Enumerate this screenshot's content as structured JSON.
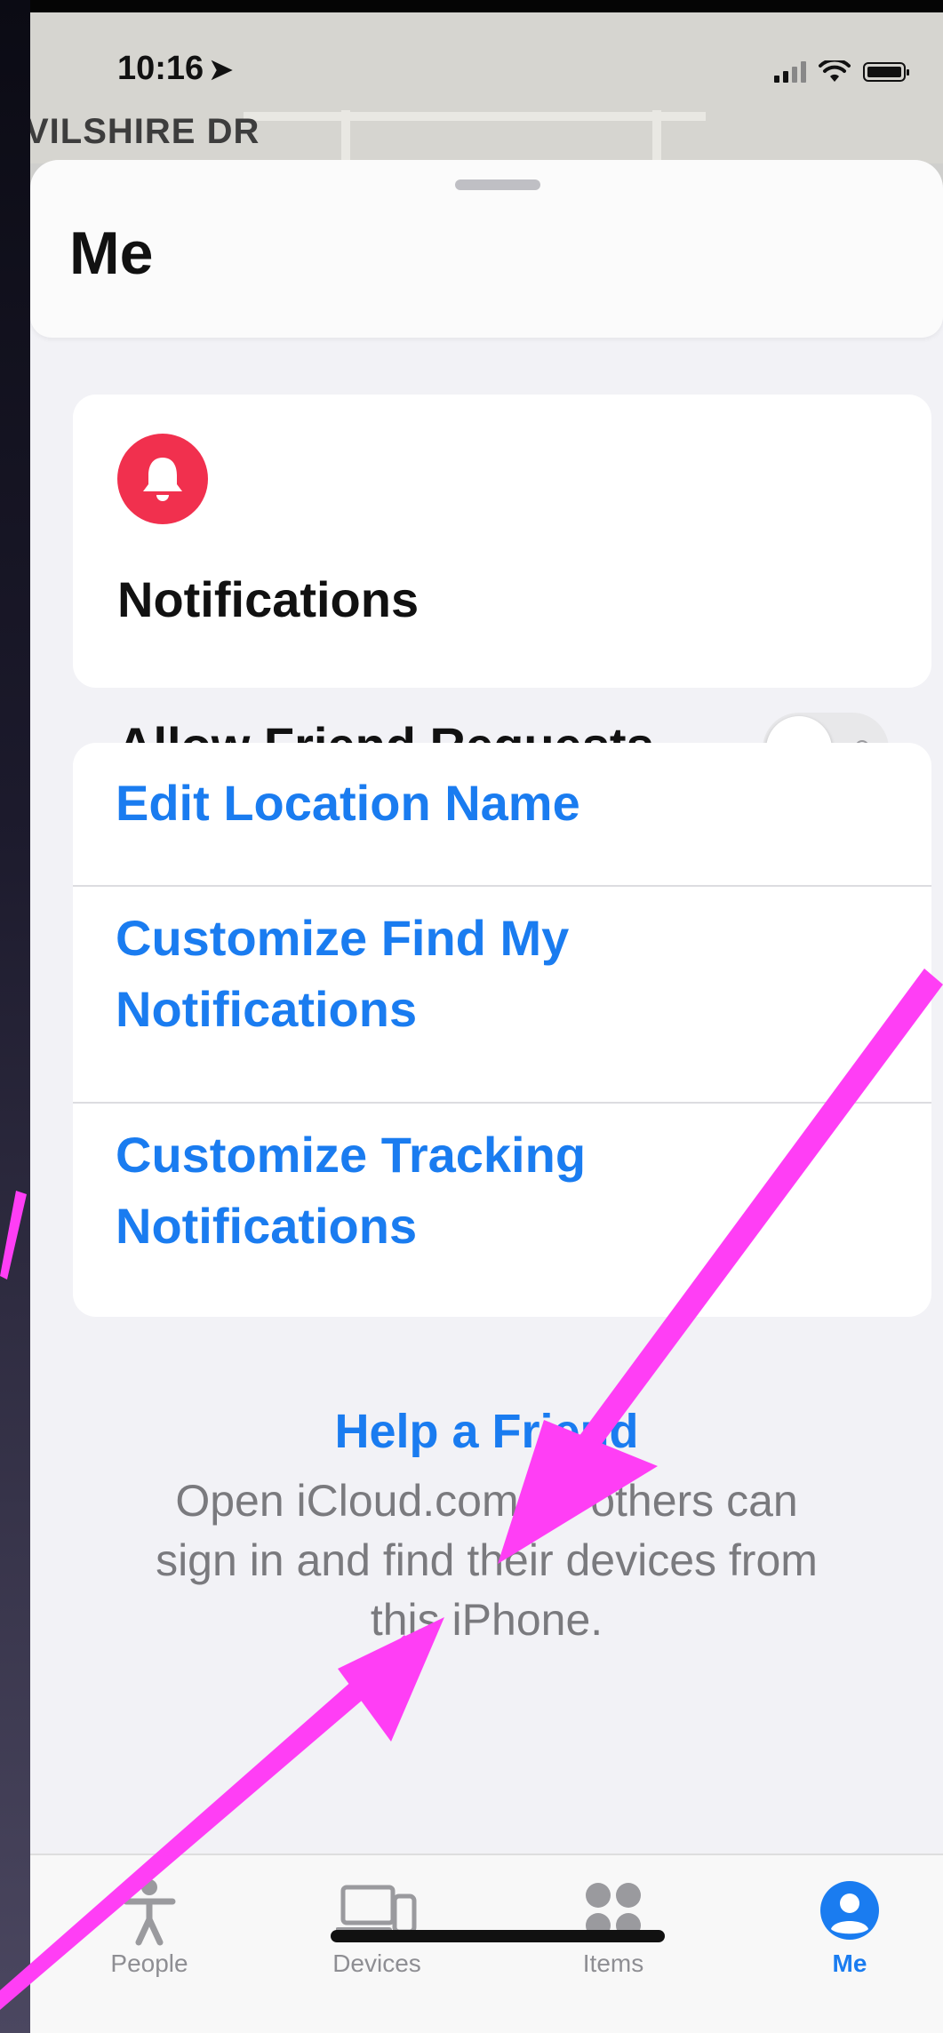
{
  "status_bar": {
    "time": "10:16"
  },
  "map": {
    "street_label": "VILSHIRE DR"
  },
  "sheet": {
    "title": "Me"
  },
  "notifications": {
    "heading": "Notifications",
    "allow_friend_requests_label": "Allow Friend Requests",
    "allow_friend_requests_on": false
  },
  "links": {
    "edit_location_name": "Edit Location Name",
    "customize_find_my_line1": "Customize Find My",
    "customize_find_my_line2": "Notifications",
    "customize_tracking_line1": "Customize Tracking",
    "customize_tracking_line2": "Notifications"
  },
  "help": {
    "title": "Help a Friend",
    "description": "Open iCloud.com so others can sign in and find their devices from this iPhone."
  },
  "tabbar": {
    "people": "People",
    "devices": "Devices",
    "items": "Items",
    "me": "Me"
  },
  "colors": {
    "accent": "#1a7cf0",
    "bell": "#f1304e",
    "annotation_arrow": "#ff3ef5"
  }
}
